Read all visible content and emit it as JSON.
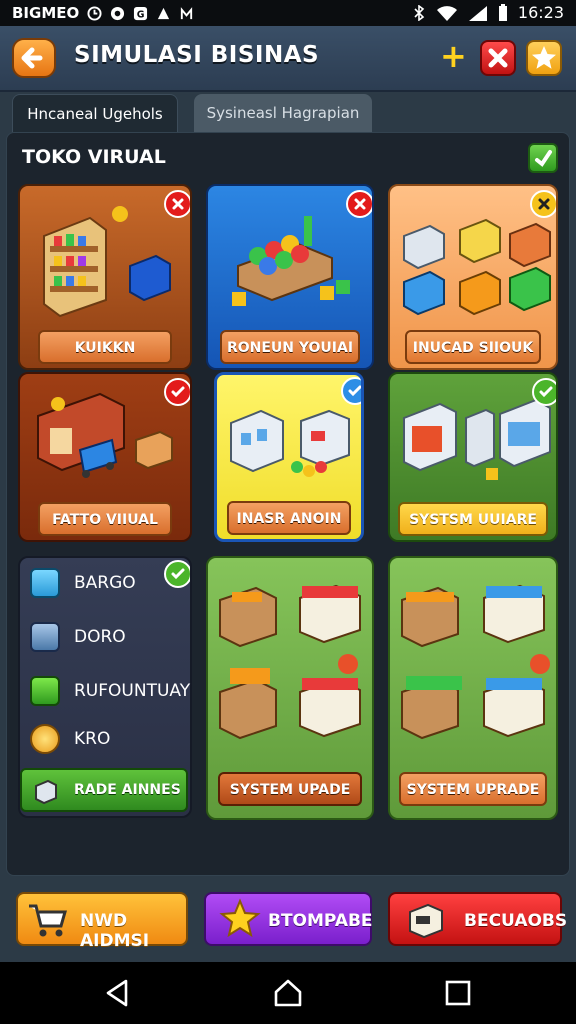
{
  "status_bar": {
    "left_text": "BIGMEO",
    "time": "16:23"
  },
  "header": {
    "title": "SIMULASI BISINAS",
    "plus_label": "+"
  },
  "tabs": [
    {
      "label": "Hncaneal Ugehols",
      "active": true
    },
    {
      "label": "Sysineasl Hagrapian",
      "active": false
    }
  ],
  "panel": {
    "title": "TOKO VIRUAL"
  },
  "cards": {
    "kuikkn": {
      "label": "KUIKKN",
      "badge": "x"
    },
    "roneun": {
      "label": "RONEUN YOUIAI",
      "badge": "x"
    },
    "inucad": {
      "label": "INUCAD SIIOUK",
      "badge": "x"
    },
    "fatto": {
      "label": "FATTO VIIUAL",
      "badge": "check"
    },
    "inasr": {
      "label": "INASR ANOIN",
      "badge": "check"
    },
    "systsm": {
      "label": "SYSTSM UUIARE",
      "badge": "check"
    },
    "upade_left": {
      "label": "SYSTEM UPADE"
    },
    "upade_right": {
      "label": "SYSTEM UPRADE"
    }
  },
  "list_card": {
    "items": [
      {
        "label": "BARGO",
        "icon": "blue-cube-icon"
      },
      {
        "label": "DORO",
        "icon": "tower-icon"
      },
      {
        "label": "RUFOUNTUAY",
        "icon": "green-cube-icon"
      },
      {
        "label": "KRO",
        "icon": "coin-icon"
      }
    ],
    "button_label": "RADE AINNES"
  },
  "bottom_buttons": [
    {
      "label": "NWD AIDMSI",
      "icon": "shopping-cart-icon"
    },
    {
      "label": "BTOMPABE",
      "icon": "star-icon"
    },
    {
      "label": "BECUAOBS",
      "icon": "box-icon"
    }
  ],
  "colors": {
    "orange": "#e77513",
    "blue": "#2466c9",
    "yellow": "#f3e44a",
    "green": "#4d8f31",
    "red": "#d81717",
    "purple": "#8e2ee0"
  }
}
